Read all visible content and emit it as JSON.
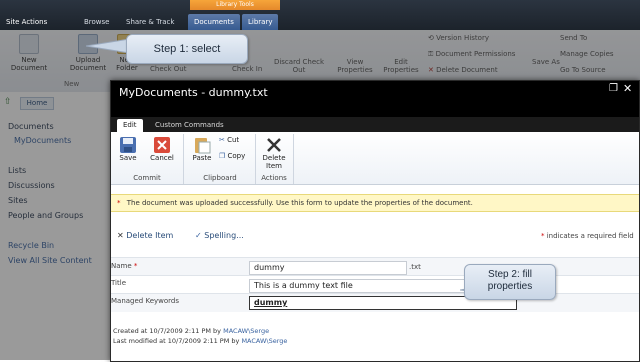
{
  "top_bar": {
    "site_actions": "Site Actions",
    "tabs": [
      "Browse",
      "Share & Track",
      "Documents",
      "Library"
    ],
    "context_tab": "Library Tools"
  },
  "bg_ribbon": {
    "new_document": "New Document",
    "new_folder": "New Folder",
    "upload_document": "Upload Document",
    "group_new": "New",
    "version_history": "Version History",
    "document_permissions": "Document Permissions",
    "delete_document": "Delete Document",
    "send_to": "Send To",
    "manage_copies": "Manage Copies",
    "go_to_source": "Go To Source",
    "view_properties": "View Properties",
    "edit_properties": "Edit Properties",
    "discard_checkout": "Discard Check Out",
    "checkin": "Check In",
    "checkout": "Check Out",
    "save_as": "Save As"
  },
  "left_nav": {
    "home": "Home",
    "items": [
      "Documents",
      "MyDocuments",
      "Lists",
      "Discussions",
      "Sites",
      "People and Groups",
      "Recycle Bin",
      "View All Site Content"
    ]
  },
  "dialog": {
    "title": "MyDocuments - dummy.txt",
    "tabs": [
      "Edit",
      "Custom Commands"
    ],
    "ribbon": {
      "save": "Save",
      "cancel": "Cancel",
      "paste": "Paste",
      "cut": "Cut",
      "copy": "Copy",
      "delete_item": "Delete Item",
      "group_commit": "Commit",
      "group_clipboard": "Clipboard",
      "group_actions": "Actions"
    },
    "notice": "The document was uploaded successfully. Use this form to update the properties of the document.",
    "action_delete": "Delete Item",
    "action_spelling": "Spelling...",
    "required_note": "indicates a required field",
    "fields": {
      "name_label": "Name",
      "name_value": "dummy",
      "name_ext": ".txt",
      "title_label": "Title",
      "title_value": "This is a dummy text file",
      "keywords_label": "Managed Keywords",
      "keywords_value": "dummy"
    },
    "meta": {
      "created": "Created at 10/7/2009 2:11 PM by",
      "modified": "Last modified at 10/7/2009 2:11 PM by",
      "user": "MACAW\\Serge"
    }
  },
  "callouts": {
    "step1": "Step 1: select",
    "step2": "Step 2: fill properties"
  },
  "colors": {
    "accent": "#375b91",
    "context": "#e5892b",
    "notice_bg": "#fff7c6",
    "required": "#cc0000"
  }
}
